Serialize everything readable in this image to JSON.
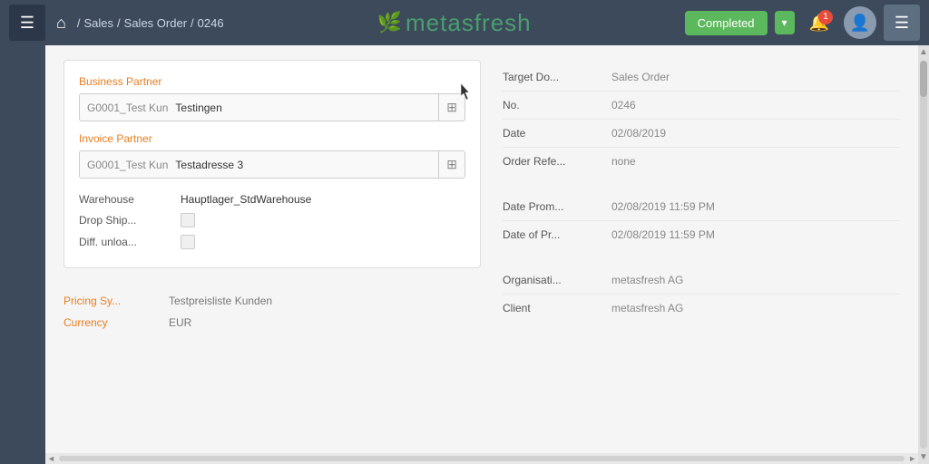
{
  "header": {
    "menu_icon": "☰",
    "home_icon": "🏠",
    "breadcrumb": {
      "sales": "Sales",
      "sep1": "/",
      "sales_order": "Sales Order",
      "sep2": "/",
      "order_num": "0246"
    },
    "logo": "metasfresh",
    "status_label": "Completed",
    "dropdown_icon": "▾",
    "notification_count": "1",
    "sidebar_icon": "☰"
  },
  "form": {
    "business_partner_label": "Business Partner",
    "business_partner_part1": "G0001_Test Kun",
    "business_partner_part2": "Testingen",
    "invoice_partner_label": "Invoice Partner",
    "invoice_partner_part1": "G0001_Test Kun",
    "invoice_partner_part2": "Testadresse 3",
    "warehouse_label": "Warehouse",
    "warehouse_value": "Hauptlager_StdWarehouse",
    "drop_ship_label": "Drop Ship...",
    "diff_unload_label": "Diff. unloa..."
  },
  "extra": {
    "pricing_sys_label": "Pricing Sy...",
    "pricing_sys_value": "Testpreisliste Kunden",
    "currency_label": "Currency",
    "currency_value": "EUR"
  },
  "info": {
    "target_doc_label": "Target Do...",
    "target_doc_value": "Sales Order",
    "no_label": "No.",
    "no_value": "0246",
    "date_label": "Date",
    "date_value": "02/08/2019",
    "order_ref_label": "Order Refe...",
    "order_ref_value": "none",
    "date_prom_label": "Date Prom...",
    "date_prom_value": "02/08/2019 11:59 PM",
    "date_pr_label": "Date of Pr...",
    "date_pr_value": "02/08/2019 11:59 PM",
    "organisation_label": "Organisati...",
    "organisation_value": "metasfresh AG",
    "client_label": "Client",
    "client_value": "metasfresh AG"
  }
}
